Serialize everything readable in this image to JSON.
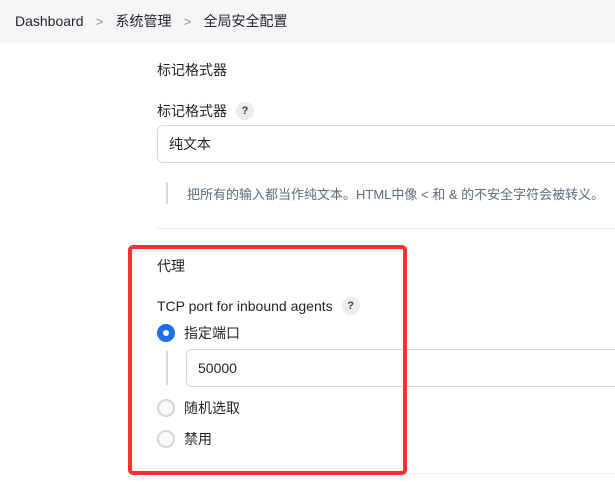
{
  "breadcrumb": {
    "items": [
      "Dashboard",
      "系统管理",
      "全局安全配置"
    ]
  },
  "markup_formatter": {
    "section_title": "标记格式器",
    "field_label": "标记格式器",
    "help_glyph": "?",
    "selected_value": "纯文本",
    "help_text": "把所有的输入都当作纯文本。HTML中像 < 和 & 的不安全字符会被转义。"
  },
  "agents": {
    "section_title": "代理",
    "field_label": "TCP port for inbound agents",
    "help_glyph": "?",
    "options": [
      {
        "label": "指定端口",
        "checked": true
      },
      {
        "label": "随机选取",
        "checked": false
      },
      {
        "label": "禁用",
        "checked": false
      }
    ],
    "port_value": "50000"
  },
  "colors": {
    "accent": "#1c6fe8",
    "highlight": "#f5322d"
  }
}
